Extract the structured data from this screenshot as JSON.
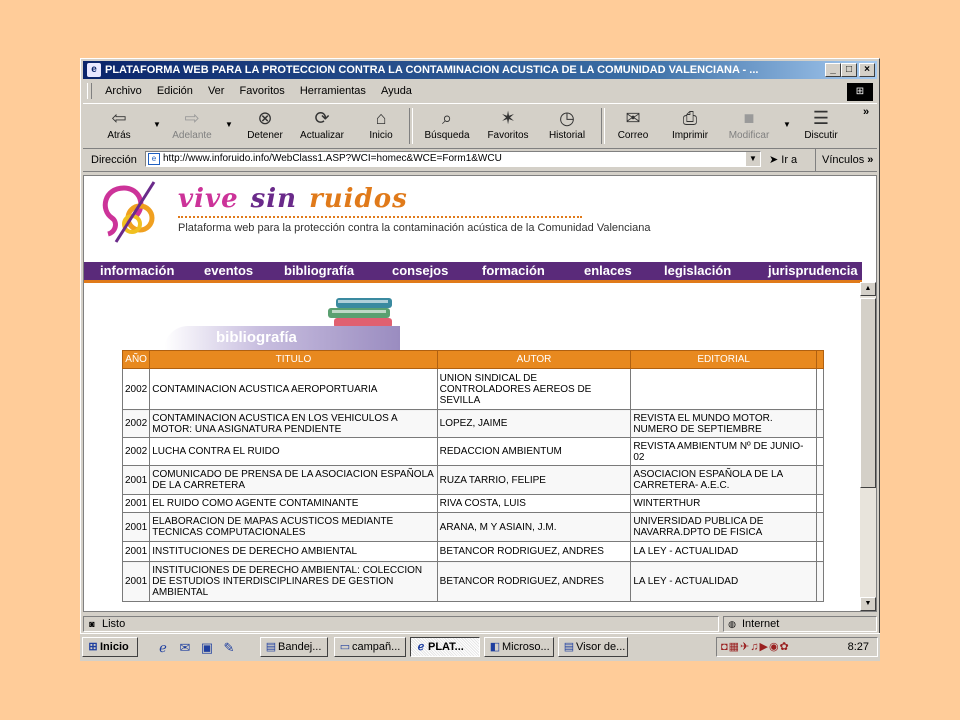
{
  "window": {
    "title": "PLATAFORMA WEB PARA LA PROTECCION CONTRA LA CONTAMINACION ACUSTICA DE LA COMUNIDAD VALENCIANA - ...",
    "buttons": {
      "minimize": "_",
      "maximize": "□",
      "close": "×"
    }
  },
  "menu": [
    "Archivo",
    "Edición",
    "Ver",
    "Favoritos",
    "Herramientas",
    "Ayuda"
  ],
  "toolbar": {
    "back": "Atrás",
    "forward": "Adelante",
    "stop": "Detener",
    "refresh": "Actualizar",
    "home": "Inicio",
    "search": "Búsqueda",
    "favorites": "Favoritos",
    "history": "Historial",
    "mail": "Correo",
    "print": "Imprimir",
    "edit": "Modificar",
    "discuss": "Discutir",
    "more": "»"
  },
  "address": {
    "label": "Dirección",
    "url": "http://www.inforuido.info/WebClass1.ASP?WCI=homec&WCE=Form1&WCU",
    "go": "Ir a",
    "links": "Vínculos",
    "more": "»"
  },
  "site": {
    "brand_words": [
      "vive",
      "sin",
      "ruidos"
    ],
    "subtitle": "Plataforma web para la protección contra la contaminación acústica de la Comunidad Valenciana",
    "nav": [
      "información",
      "eventos",
      "bibliografía",
      "consejos",
      "formación",
      "enlaces",
      "legislación",
      "jurisprudencia"
    ],
    "section_title": "bibliografía",
    "table": {
      "headers": [
        "AÑO",
        "TITULO",
        "AUTOR",
        "EDITORIAL"
      ],
      "rows": [
        {
          "year": "2002",
          "title": "CONTAMINACION ACUSTICA AEROPORTUARIA",
          "author": "UNION SINDICAL DE CONTROLADORES AEREOS DE SEVILLA",
          "editorial": ""
        },
        {
          "year": "2002",
          "title": "CONTAMINACION ACUSTICA EN LOS VEHICULOS A MOTOR: UNA ASIGNATURA PENDIENTE",
          "author": "LOPEZ, JAIME",
          "editorial": "REVISTA EL MUNDO MOTOR. NUMERO DE SEPTIEMBRE"
        },
        {
          "year": "2002",
          "title": "LUCHA CONTRA EL RUIDO",
          "author": "REDACCION AMBIENTUM",
          "editorial": "REVISTA AMBIENTUM Nº DE JUNIO-02"
        },
        {
          "year": "2001",
          "title": "COMUNICADO DE PRENSA DE LA ASOCIACION ESPAÑOLA DE LA CARRETERA",
          "author": "RUZA TARRIO, FELIPE",
          "editorial": "ASOCIACION ESPAÑOLA DE LA CARRETERA- A.E.C."
        },
        {
          "year": "2001",
          "title": "EL RUIDO COMO AGENTE CONTAMINANTE",
          "author": "RIVA COSTA, LUIS",
          "editorial": "WINTERTHUR"
        },
        {
          "year": "2001",
          "title": "ELABORACION DE MAPAS ACUSTICOS MEDIANTE TECNICAS COMPUTACIONALES",
          "author": "ARANA, M Y ASIAIN, J.M.",
          "editorial": "UNIVERSIDAD PUBLICA DE NAVARRA.DPTO DE FISICA"
        },
        {
          "year": "2001",
          "title": "INSTITUCIONES DE DERECHO AMBIENTAL",
          "author": "BETANCOR RODRIGUEZ, ANDRES",
          "editorial": "LA LEY - ACTUALIDAD"
        },
        {
          "year": "2001",
          "title": "INSTITUCIONES DE DERECHO AMBIENTAL: COLECCION DE ESTUDIOS INTERDISCIPLINARES DE GESTION AMBIENTAL",
          "author": "BETANCOR RODRIGUEZ, ANDRES",
          "editorial": "LA LEY - ACTUALIDAD"
        }
      ]
    }
  },
  "status": {
    "left": "Listo",
    "zone": "Internet"
  },
  "taskbar": {
    "start": "Inicio",
    "tasks": [
      "Bandej...",
      "campañ...",
      "PLAT...",
      "Microso...",
      "Visor de..."
    ],
    "active_task": "PLAT...",
    "clock": "8:27"
  },
  "colors": {
    "nav_bg": "#5a2a7a",
    "accent_orange": "#e07a1a",
    "titlebar": "#0a246a",
    "desktop": "#FFCC99"
  }
}
